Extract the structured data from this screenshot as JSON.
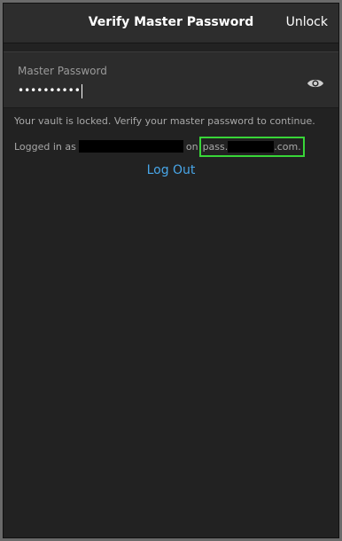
{
  "header": {
    "title": "Verify Master Password",
    "unlock_label": "Unlock"
  },
  "password_field": {
    "label": "Master Password",
    "masked_value": "••••••••••"
  },
  "icons": {
    "toggle_visibility": "eye-icon"
  },
  "message": "Your vault is locked. Verify your master password to continue.",
  "login_info": {
    "prefix": "Logged in as",
    "on_text": "on",
    "domain_prefix": "pass.",
    "domain_suffix": ".com."
  },
  "logout_label": "Log Out",
  "colors": {
    "accent_link": "#48a6e8",
    "highlight_box": "#38d638",
    "background": "#222222"
  }
}
